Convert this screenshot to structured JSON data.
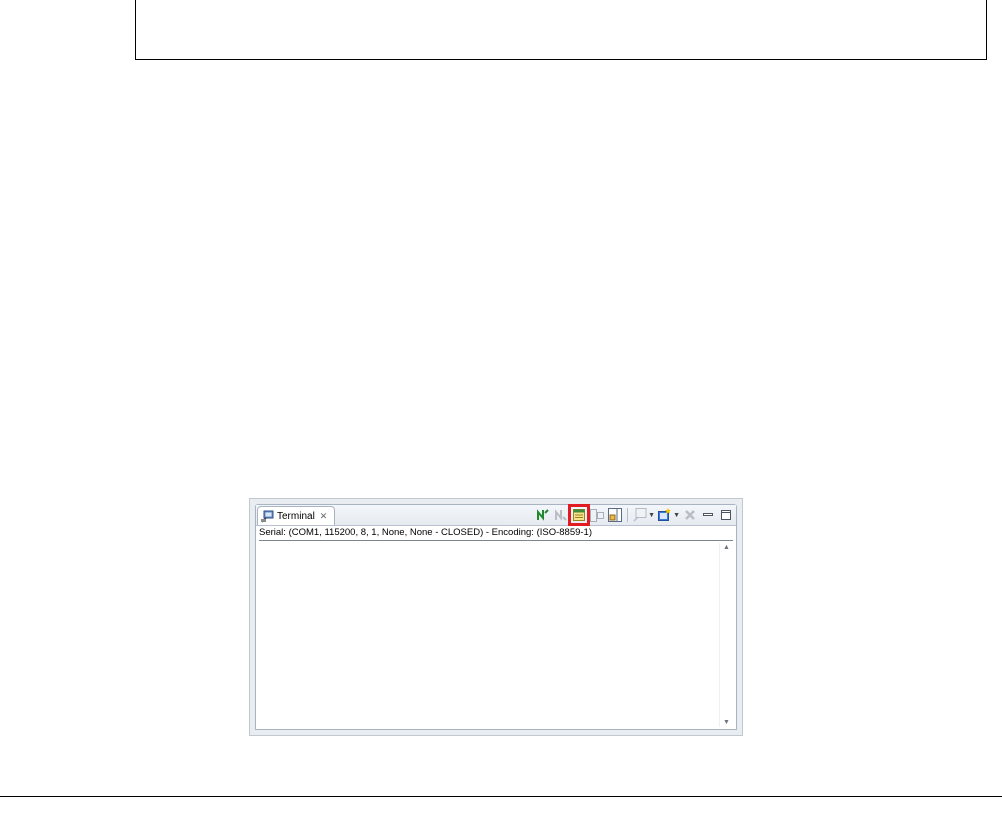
{
  "view": {
    "tab_label": "Terminal",
    "tab_close": "✕",
    "tab_icon": "terminal-icon",
    "status_line": "Serial: (COM1, 115200, 8, 1, None, None - CLOSED) - Encoding: (ISO-8859-1)",
    "toolbar": [
      {
        "name": "connect-icon",
        "enabled": true
      },
      {
        "name": "disconnect-icon",
        "enabled": false
      },
      {
        "name": "settings-icon",
        "enabled": true,
        "highlighted": true
      },
      {
        "name": "toggle-command-input-icon",
        "enabled": false
      },
      {
        "name": "scroll-lock-icon",
        "enabled": true
      },
      {
        "name": "copy-icon",
        "enabled": false
      },
      {
        "name": "new-terminal-icon",
        "enabled": true
      },
      {
        "name": "remove-terminal-icon",
        "enabled": false
      },
      {
        "name": "minimize-icon",
        "enabled": true
      },
      {
        "name": "maximize-icon",
        "enabled": true
      }
    ],
    "highlight_color": "#e11b22"
  }
}
